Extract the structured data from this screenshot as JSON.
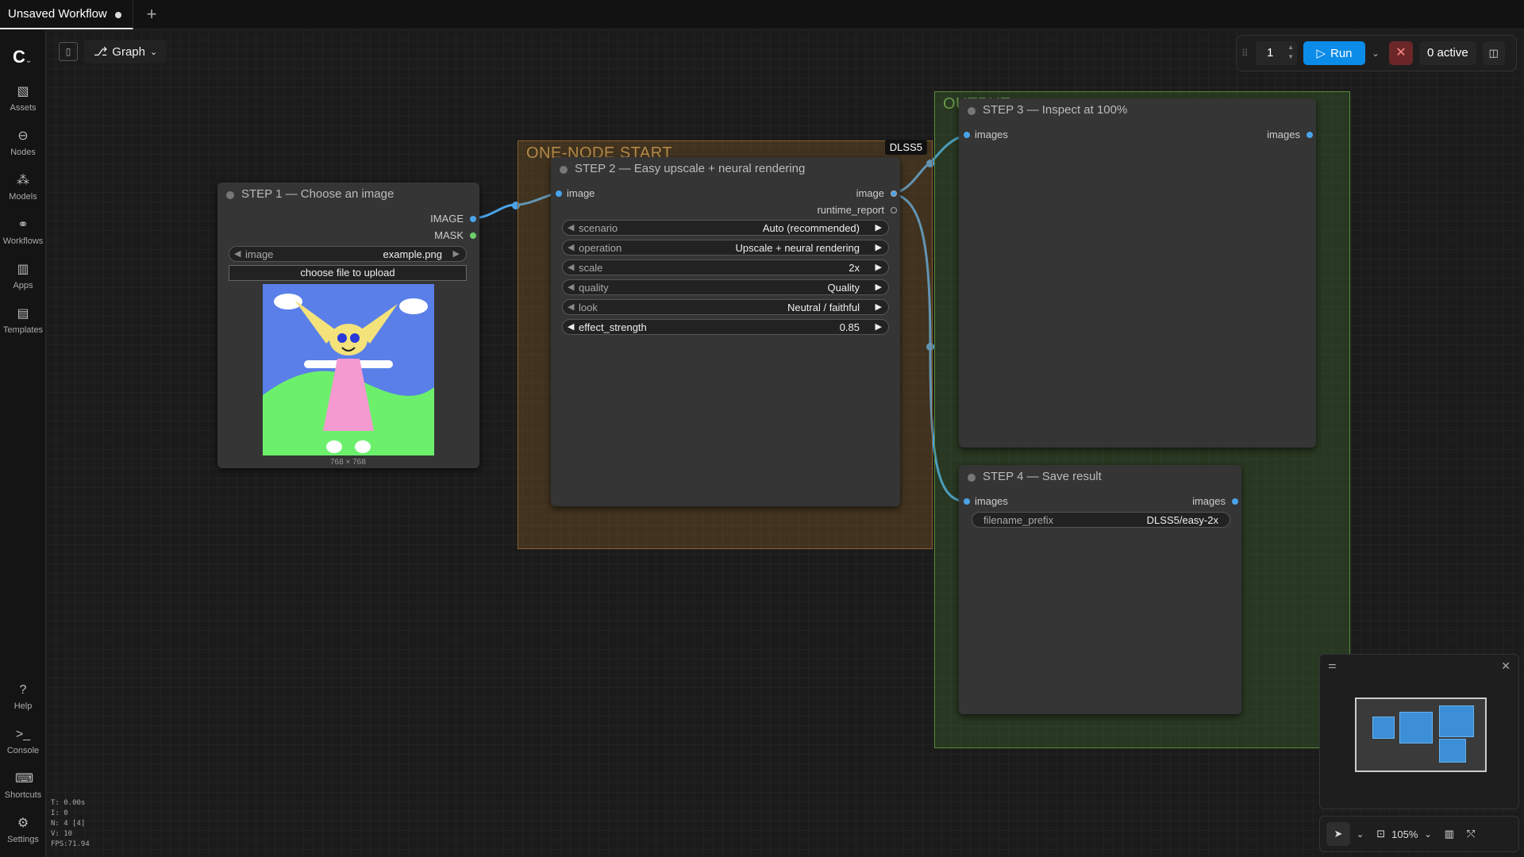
{
  "tab": {
    "title": "Unsaved Workflow"
  },
  "sidebar": {
    "items": [
      {
        "label": "Assets",
        "icon": "image-icon"
      },
      {
        "label": "Nodes",
        "icon": "node-icon"
      },
      {
        "label": "Models",
        "icon": "models-icon"
      },
      {
        "label": "Workflows",
        "icon": "workflow-icon"
      },
      {
        "label": "Apps",
        "icon": "apps-icon"
      },
      {
        "label": "Templates",
        "icon": "templates-icon"
      }
    ],
    "bottom": [
      {
        "label": "Help",
        "icon": "help-icon"
      },
      {
        "label": "Console",
        "icon": "console-icon"
      },
      {
        "label": "Shortcuts",
        "icon": "keyboard-icon"
      },
      {
        "label": "Settings",
        "icon": "gear-icon"
      }
    ]
  },
  "toolbar": {
    "graph_label": "Graph"
  },
  "runbar": {
    "count": "1",
    "run_label": "Run",
    "active_label": "0 active"
  },
  "groups": {
    "one_node": {
      "title": "ONE-NODE START",
      "badge": "DLSS5",
      "color": "#b58a4a"
    },
    "output": {
      "title": "OUTPUT",
      "color": "#6a9a4a"
    }
  },
  "nodes": {
    "step1": {
      "title": "STEP 1 — Choose an image",
      "out_image": "IMAGE",
      "out_mask": "MASK",
      "image_label": "image",
      "image_value": "example.png",
      "upload_label": "choose file to upload",
      "dims": "768 × 768"
    },
    "step2": {
      "title": "STEP 2 — Easy upscale + neural rendering",
      "in_image": "image",
      "out_image": "image",
      "out_report": "runtime_report",
      "widgets": [
        {
          "label": "scenario",
          "value": "Auto (recommended)"
        },
        {
          "label": "operation",
          "value": "Upscale + neural rendering"
        },
        {
          "label": "scale",
          "value": "2x"
        },
        {
          "label": "quality",
          "value": "Quality"
        },
        {
          "label": "look",
          "value": "Neutral / faithful"
        },
        {
          "label": "effect_strength",
          "value": "0.85"
        }
      ]
    },
    "step3": {
      "title": "STEP 3 — Inspect at 100%",
      "in_images": "images",
      "out_images": "images"
    },
    "step4": {
      "title": "STEP 4 — Save result",
      "in_images": "images",
      "out_images": "images",
      "prefix_label": "filename_prefix",
      "prefix_value": "DLSS5/easy-2x"
    }
  },
  "stats": {
    "t": "T: 0.00s",
    "i": "I: 0",
    "n": "N: 4 [4]",
    "v": "V: 10",
    "fps": "FPS:71.94"
  },
  "zoom": {
    "level": "105%"
  },
  "colors": {
    "link": "#4aa3e8",
    "run": "#0b8ce9",
    "node": "#353535"
  }
}
